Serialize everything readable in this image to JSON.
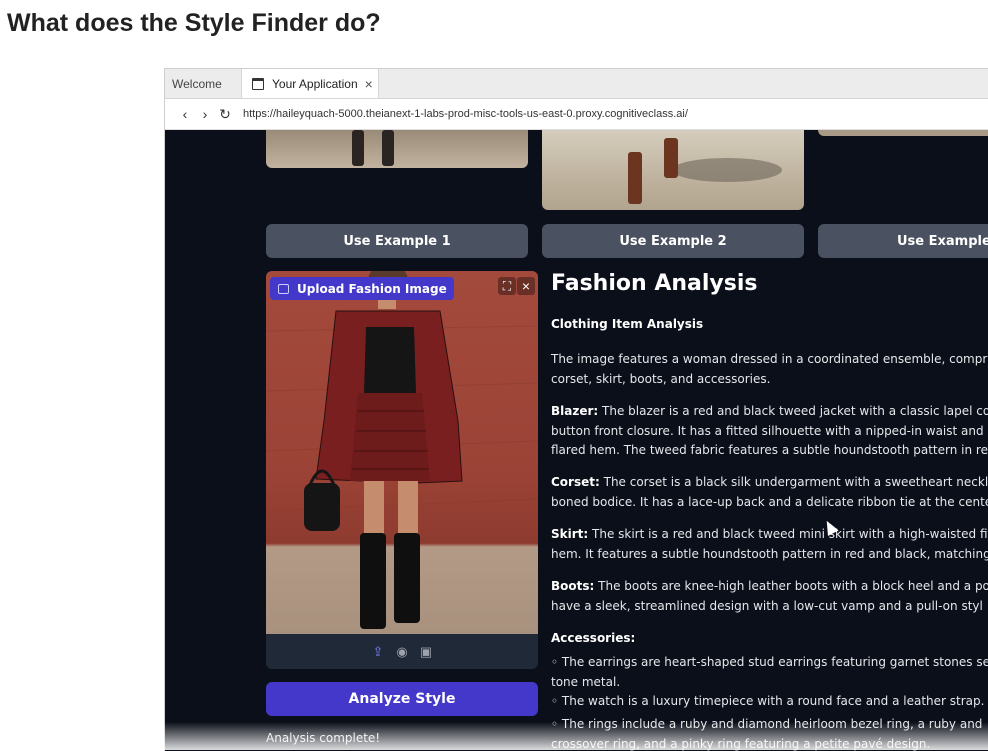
{
  "page": {
    "heading": "What does the Style Finder do?"
  },
  "browser": {
    "tabs": [
      {
        "label": "Welcome"
      },
      {
        "label": "Your Application"
      }
    ],
    "url": "https://haileyquach-5000.theianext-1-labs-prod-misc-tools-us-east-0.proxy.cognitiveclass.ai/"
  },
  "examples": {
    "buttons": [
      "Use Example 1",
      "Use Example 2",
      "Use Example"
    ]
  },
  "upload": {
    "label": "Upload Fashion Image"
  },
  "actions": {
    "analyze_label": "Analyze Style",
    "status": "Analysis complete!"
  },
  "analysis": {
    "title": "Fashion Analysis",
    "section_title": "Clothing Item Analysis",
    "intro": [
      "The image features a woman dressed in a coordinated ensemble, compr",
      "corset, skirt, boots, and accessories."
    ],
    "blazer": {
      "term": "Blazer:",
      "lines": [
        " The blazer is a red and black tweed jacket with a classic lapel col",
        "button front closure. It has a fitted silhouette with a nipped-in waist and",
        "flared hem. The tweed fabric features a subtle houndstooth pattern in rec"
      ]
    },
    "corset": {
      "term": "Corset:",
      "lines": [
        " The corset is a black silk undergarment with a sweetheart neckli",
        "boned bodice. It has a lace-up back and a delicate ribbon tie at the cente"
      ]
    },
    "skirt": {
      "term": "Skirt:",
      "lines": [
        " The skirt is a red and black tweed mini skirt with a high-waisted fit",
        "hem. It features a subtle houndstooth pattern in red and black, matching"
      ]
    },
    "boots": {
      "term": "Boots:",
      "lines": [
        " The boots are knee-high leather boots with a block heel and a poi",
        "have a sleek, streamlined design with a low-cut vamp and a pull-on styl"
      ]
    },
    "accessories_title": "Accessories:",
    "accessories": [
      [
        "◦ The earrings are heart-shaped stud earrings featuring garnet stones se",
        "tone metal."
      ],
      [
        "◦ The watch is a luxury timepiece with a round face and a leather strap."
      ],
      [
        "◦ The rings include a ruby and diamond heirloom bezel ring, a ruby and",
        "crossover ring, and a pinky ring featuring a petite pavé design."
      ]
    ]
  },
  "colors": {
    "app_bg": "#0b0f19",
    "accent": "#4338ca",
    "button_gray": "#4a5160"
  }
}
